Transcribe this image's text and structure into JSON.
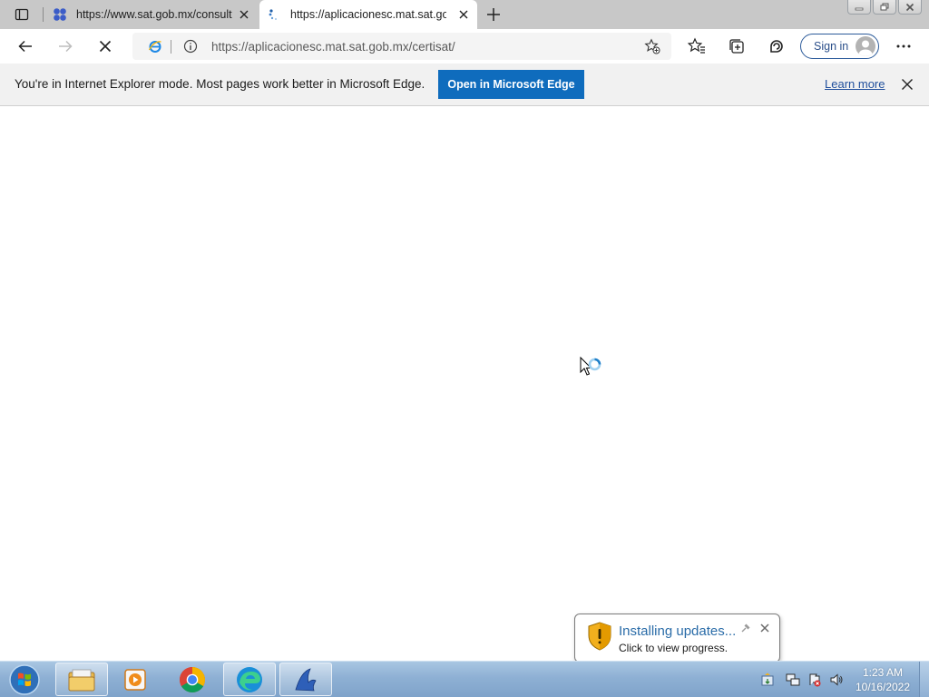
{
  "browser": {
    "tabs": [
      {
        "title": "https://www.sat.gob.mx/consulta",
        "favicon": "sat-favicon-icon"
      },
      {
        "title": "https://aplicacionesc.mat.sat.gob",
        "favicon": "loading-spinner-icon"
      }
    ],
    "address": {
      "url": "https://aplicacionesc.mat.sat.gob.mx/certisat/",
      "mode_icon": "ie-mode-icon"
    },
    "signin_label": "Sign in"
  },
  "infobar": {
    "message": "You're in Internet Explorer mode. Most pages work better in Microsoft Edge.",
    "button_label": "Open in Microsoft Edge",
    "learn_more": "Learn more"
  },
  "notification": {
    "title": "Installing updates...",
    "subtitle": "Click to view progress."
  },
  "taskbar": {
    "apps": [
      "windows-explorer-icon",
      "media-player-icon",
      "chrome-icon",
      "edge-icon",
      "custom-app-icon"
    ],
    "time": "1:23 AM",
    "date": "10/16/2022"
  },
  "colors": {
    "accent": "#0f6cbd",
    "taskbar": "#8eb0d4"
  }
}
